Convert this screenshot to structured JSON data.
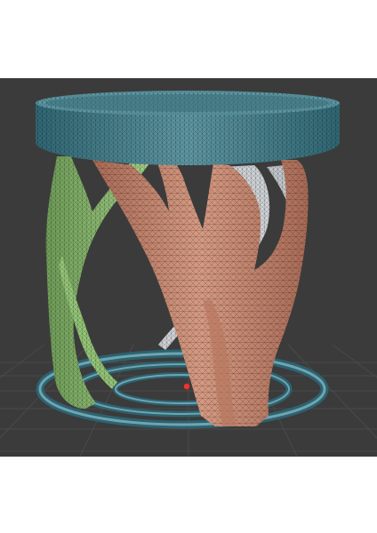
{
  "viewport": {
    "background": "#3b3b3b",
    "grid_color": "#4d4d4d",
    "model": {
      "parts": [
        {
          "name": "top-ring",
          "color": "#3f7f8c"
        },
        {
          "name": "bottom-rings",
          "color": "#3f7f8c"
        },
        {
          "name": "brown-branch-structure",
          "color": "#c98a73"
        },
        {
          "name": "green-branch-structure",
          "color": "#8fbf72"
        },
        {
          "name": "white-branch-structure",
          "color": "#cfd2d6"
        }
      ],
      "marker_color": "#ff2d2d",
      "mesh_color": "#1a1a1a"
    }
  }
}
